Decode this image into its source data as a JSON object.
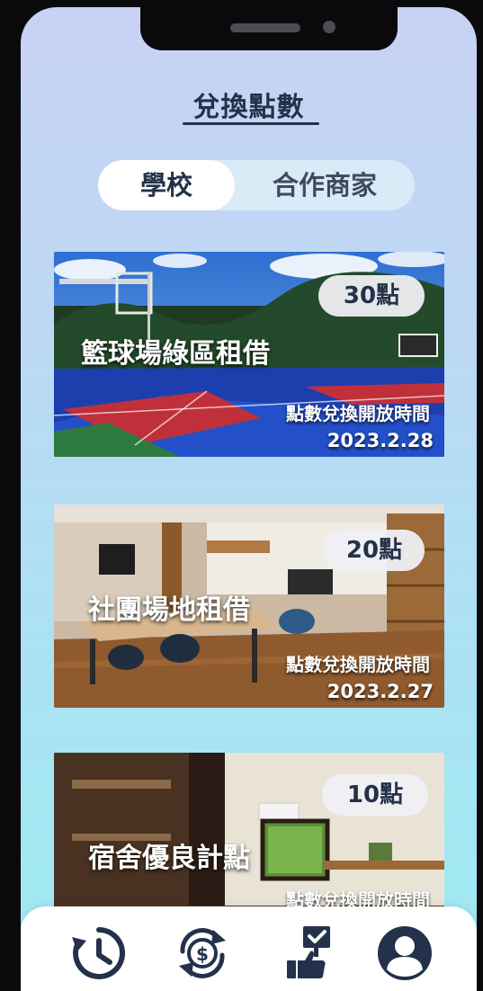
{
  "page": {
    "title": "兌換點數"
  },
  "tabs": [
    {
      "label": "學校",
      "active": true
    },
    {
      "label": "合作商家",
      "active": false
    }
  ],
  "cards": [
    {
      "title": "籃球場綠區租借",
      "points": "30點",
      "open_label": "點數兌換開放時間",
      "open_date": "2023.2.28"
    },
    {
      "title": "社團場地租借",
      "points": "20點",
      "open_label": "點數兌換開放時間",
      "open_date": "2023.2.27"
    },
    {
      "title": "宿舍優良計點",
      "points": "10點",
      "open_label": "點數兌換開放時間"
    }
  ],
  "bottom_nav": [
    {
      "icon": "history-icon"
    },
    {
      "icon": "currency-exchange-icon"
    },
    {
      "icon": "checklist-thumbs-up-icon"
    },
    {
      "icon": "user-profile-icon"
    }
  ],
  "colors": {
    "primary_text": "#23324a",
    "tab_active_bg": "#ffffff",
    "tab_track_bg": "#d8ebf6",
    "badge_bg": "#f0f0f4"
  }
}
